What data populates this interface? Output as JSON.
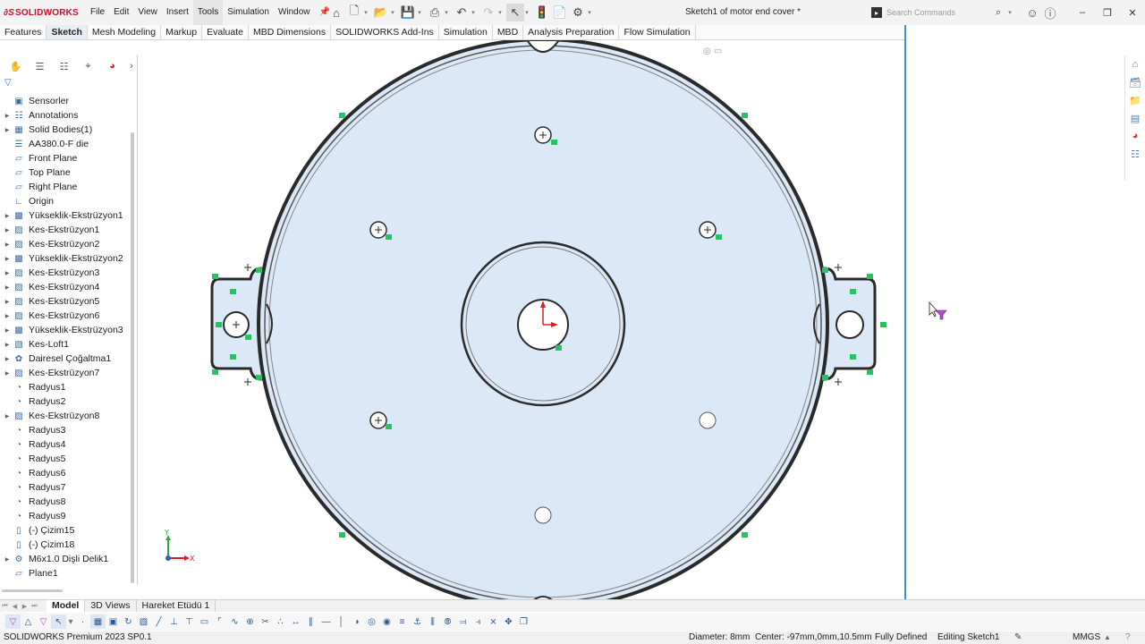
{
  "app": {
    "logo_ds": "∂S",
    "logo_text": "SOLIDWORKS"
  },
  "menu": {
    "file": "File",
    "edit": "Edit",
    "view": "View",
    "insert": "Insert",
    "tools": "Tools",
    "simulation": "Simulation",
    "window": "Window"
  },
  "document": {
    "title": "Sketch1 of motor end cover *"
  },
  "search": {
    "placeholder": "Search Commands"
  },
  "command_tabs": [
    "Features",
    "Sketch",
    "Mesh Modeling",
    "Markup",
    "Evaluate",
    "MBD Dimensions",
    "SOLIDWORKS Add-Ins",
    "Simulation",
    "MBD",
    "Analysis Preparation",
    "Flow Simulation"
  ],
  "feature_tree": [
    {
      "label": "Sensorler",
      "icon": "sensor-icon",
      "expandable": false
    },
    {
      "label": "Annotations",
      "icon": "annotations-icon",
      "expandable": true
    },
    {
      "label": "Solid Bodies(1)",
      "icon": "solid-bodies-icon",
      "expandable": true
    },
    {
      "label": "AA380.0-F die",
      "icon": "material-icon",
      "expandable": false
    },
    {
      "label": "Front Plane",
      "icon": "plane-icon",
      "expandable": false
    },
    {
      "label": "Top Plane",
      "icon": "plane-icon",
      "expandable": false
    },
    {
      "label": "Right Plane",
      "icon": "plane-icon",
      "expandable": false
    },
    {
      "label": "Origin",
      "icon": "origin-icon",
      "expandable": false
    },
    {
      "label": "Yükseklik-Ekstrüzyon1",
      "icon": "boss-extrude-icon",
      "expandable": true
    },
    {
      "label": "Kes-Ekstrüzyon1",
      "icon": "cut-extrude-icon",
      "expandable": true
    },
    {
      "label": "Kes-Ekstrüzyon2",
      "icon": "cut-extrude-icon",
      "expandable": true
    },
    {
      "label": "Yükseklik-Ekstrüzyon2",
      "icon": "boss-extrude-icon",
      "expandable": true
    },
    {
      "label": "Kes-Ekstrüzyon3",
      "icon": "cut-extrude-icon",
      "expandable": true
    },
    {
      "label": "Kes-Ekstrüzyon4",
      "icon": "cut-extrude-icon",
      "expandable": true
    },
    {
      "label": "Kes-Ekstrüzyon5",
      "icon": "cut-extrude-icon",
      "expandable": true
    },
    {
      "label": "Kes-Ekstrüzyon6",
      "icon": "cut-extrude-icon",
      "expandable": true
    },
    {
      "label": "Yükseklik-Ekstrüzyon3",
      "icon": "boss-extrude-icon",
      "expandable": true
    },
    {
      "label": "Kes-Loft1",
      "icon": "cut-loft-icon",
      "expandable": true
    },
    {
      "label": "Dairesel Çoğaltma1",
      "icon": "circular-pattern-icon",
      "expandable": true
    },
    {
      "label": "Kes-Ekstrüzyon7",
      "icon": "cut-extrude-icon",
      "expandable": true
    },
    {
      "label": "Radyus1",
      "icon": "fillet-icon",
      "expandable": false
    },
    {
      "label": "Radyus2",
      "icon": "fillet-icon",
      "expandable": false
    },
    {
      "label": "Kes-Ekstrüzyon8",
      "icon": "cut-extrude-icon",
      "expandable": true
    },
    {
      "label": "Radyus3",
      "icon": "fillet-icon",
      "expandable": false
    },
    {
      "label": "Radyus4",
      "icon": "fillet-icon",
      "expandable": false
    },
    {
      "label": "Radyus5",
      "icon": "fillet-icon",
      "expandable": false
    },
    {
      "label": "Radyus6",
      "icon": "fillet-icon",
      "expandable": false
    },
    {
      "label": "Radyus7",
      "icon": "fillet-icon",
      "expandable": false
    },
    {
      "label": "Radyus8",
      "icon": "fillet-icon",
      "expandable": false
    },
    {
      "label": "Radyus9",
      "icon": "fillet-icon",
      "expandable": false
    },
    {
      "label": "(-) Çizim15",
      "icon": "sketch-icon",
      "expandable": false
    },
    {
      "label": "(-) Çizim18",
      "icon": "sketch-icon",
      "expandable": false
    },
    {
      "label": "M6x1.0 Dişli Delik1",
      "icon": "hole-wizard-icon",
      "expandable": true
    },
    {
      "label": "Plane1",
      "icon": "plane-icon",
      "expandable": false
    }
  ],
  "triad": {
    "y": "Y",
    "x": "X"
  },
  "bottom_tabs": [
    "Model",
    "3D Views",
    "Hareket Etüdü 1"
  ],
  "status": {
    "product": "SOLIDWORKS Premium 2023 SP0.1",
    "diameter": "Diameter: 8mm",
    "center": "Center: -97mm,0mm,10.5mm",
    "defined": "Fully Defined",
    "editing": "Editing Sketch1",
    "units": "MMGS"
  },
  "colors": {
    "accent": "#3d8fd6",
    "part_fill": "#dbe8f8",
    "part_edge": "#2a2a2a",
    "relation_marker": "#22c55e",
    "sketch_origin": "#e02020"
  }
}
